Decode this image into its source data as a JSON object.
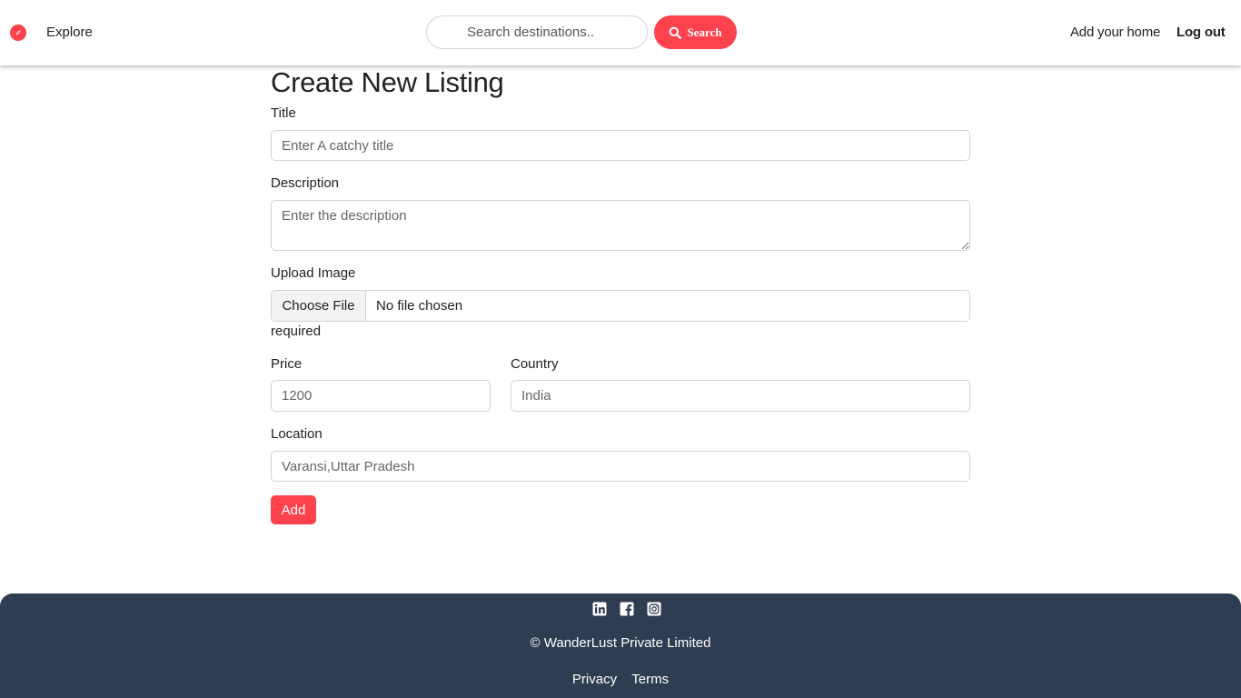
{
  "navbar": {
    "brand_icon": "compass-icon",
    "explore_label": "Explore",
    "search_placeholder": "Search destinations..",
    "search_button_label": "Search",
    "add_home_label": "Add your home",
    "logout_label": "Log out"
  },
  "form": {
    "heading": "Create New Listing",
    "title_label": "Title",
    "title_placeholder": "Enter A catchy title",
    "description_label": "Description",
    "description_placeholder": "Enter the description",
    "image_label": "Upload Image",
    "choose_file_label": "Choose File",
    "file_status": "No file chosen",
    "required_text": "required",
    "price_label": "Price",
    "price_placeholder": "1200",
    "country_label": "Country",
    "country_placeholder": "India",
    "location_label": "Location",
    "location_placeholder": "Varansi,Uttar Pradesh",
    "submit_label": "Add"
  },
  "footer": {
    "social_icons": [
      "linkedin-icon",
      "facebook-icon",
      "instagram-icon"
    ],
    "copyright": "© WanderLust Private Limited",
    "links": [
      "Privacy",
      "Terms"
    ]
  },
  "colors": {
    "accent": "#fe424d",
    "footer_bg": "#2e3d51"
  }
}
